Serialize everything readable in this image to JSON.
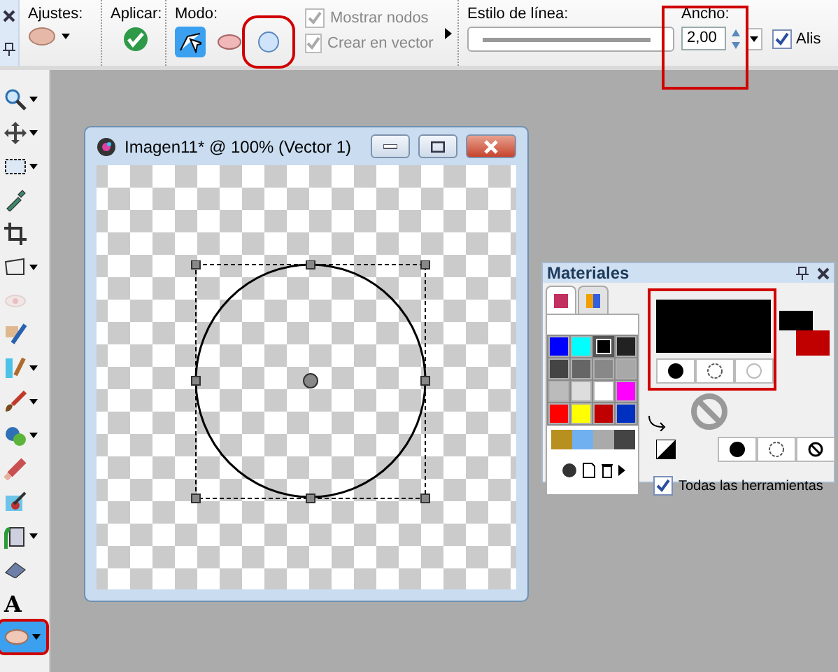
{
  "toolbar": {
    "groups": [
      {
        "label": "Ajustes:"
      },
      {
        "label": "Aplicar:"
      },
      {
        "label": "Modo:"
      }
    ],
    "modes": [
      {
        "kind": "edit",
        "selected": true,
        "highlighted": false
      },
      {
        "kind": "ellipse",
        "selected": false,
        "highlighted": false
      },
      {
        "kind": "circle",
        "selected": false,
        "highlighted": true
      }
    ],
    "options": [
      {
        "label": "Mostrar nodos",
        "checked": true,
        "disabled": true
      },
      {
        "label": "Crear en vector",
        "checked": true,
        "disabled": true
      }
    ],
    "line_style": {
      "label": "Estilo de línea:"
    },
    "width": {
      "label": "Ancho:",
      "value": "2,00",
      "highlighted": true
    },
    "antialias": {
      "label": "Alis",
      "checked": true
    }
  },
  "tools": [
    {
      "kind": "zoom",
      "menu": true,
      "selected": false,
      "disabled": false,
      "highlighted": false
    },
    {
      "kind": "move",
      "menu": true,
      "selected": false,
      "disabled": false,
      "highlighted": false
    },
    {
      "kind": "select",
      "menu": true,
      "selected": false,
      "disabled": false,
      "highlighted": false
    },
    {
      "kind": "dropper",
      "menu": false,
      "selected": false,
      "disabled": false,
      "highlighted": false
    },
    {
      "kind": "crop",
      "menu": false,
      "selected": false,
      "disabled": false,
      "highlighted": false
    },
    {
      "kind": "deform",
      "menu": true,
      "selected": false,
      "disabled": false,
      "highlighted": false
    },
    {
      "kind": "eye",
      "menu": false,
      "selected": false,
      "disabled": true,
      "highlighted": false
    },
    {
      "kind": "retouch",
      "menu": false,
      "selected": false,
      "disabled": false,
      "highlighted": false
    },
    {
      "kind": "clone",
      "menu": true,
      "selected": false,
      "disabled": false,
      "highlighted": false
    },
    {
      "kind": "brush",
      "menu": true,
      "selected": false,
      "disabled": false,
      "highlighted": false
    },
    {
      "kind": "replace",
      "menu": true,
      "selected": false,
      "disabled": false,
      "highlighted": false
    },
    {
      "kind": "pencil",
      "menu": false,
      "selected": false,
      "disabled": false,
      "highlighted": false
    },
    {
      "kind": "picture",
      "menu": false,
      "selected": false,
      "disabled": false,
      "highlighted": false
    },
    {
      "kind": "fill",
      "menu": true,
      "selected": false,
      "disabled": false,
      "highlighted": false
    },
    {
      "kind": "eraser",
      "menu": false,
      "selected": false,
      "disabled": false,
      "highlighted": false
    },
    {
      "kind": "text",
      "label": "A",
      "menu": false,
      "selected": false,
      "disabled": false,
      "highlighted": false
    },
    {
      "kind": "shape",
      "menu": true,
      "selected": true,
      "disabled": false,
      "highlighted": true
    }
  ],
  "image_window": {
    "title": "Imagen11* @ 100% (Vector 1)"
  },
  "materials": {
    "title": "Materiales",
    "tabs": [
      {
        "kind": "swatch",
        "selected": true
      },
      {
        "kind": "spectrum",
        "selected": false
      }
    ],
    "swatches": [
      {
        "color": "#0000ff",
        "selected": false
      },
      {
        "color": "#00ffff",
        "selected": false
      },
      {
        "color": "#000000",
        "selected": true
      },
      {
        "color": "#222222",
        "selected": false
      },
      {
        "color": "#444444",
        "selected": false
      },
      {
        "color": "#666666",
        "selected": false
      },
      {
        "color": "#888888",
        "selected": false
      },
      {
        "color": "#a8a8a8",
        "selected": false
      },
      {
        "color": "#bbbbbb",
        "selected": false
      },
      {
        "color": "#dddddd",
        "selected": false
      },
      {
        "color": "#ffffff",
        "selected": false
      },
      {
        "color": "#ff00ff",
        "selected": false
      },
      {
        "color": "#ff0000",
        "selected": false
      },
      {
        "color": "#ffff00",
        "selected": false
      },
      {
        "color": "#c00000",
        "selected": false
      },
      {
        "color": "#0030c0",
        "selected": false
      }
    ],
    "foreground": {
      "color": "#000000",
      "highlighted": true
    },
    "background": {
      "color": "#c00000"
    },
    "all_tools": {
      "label": "Todas las herramientas",
      "checked": true
    }
  }
}
